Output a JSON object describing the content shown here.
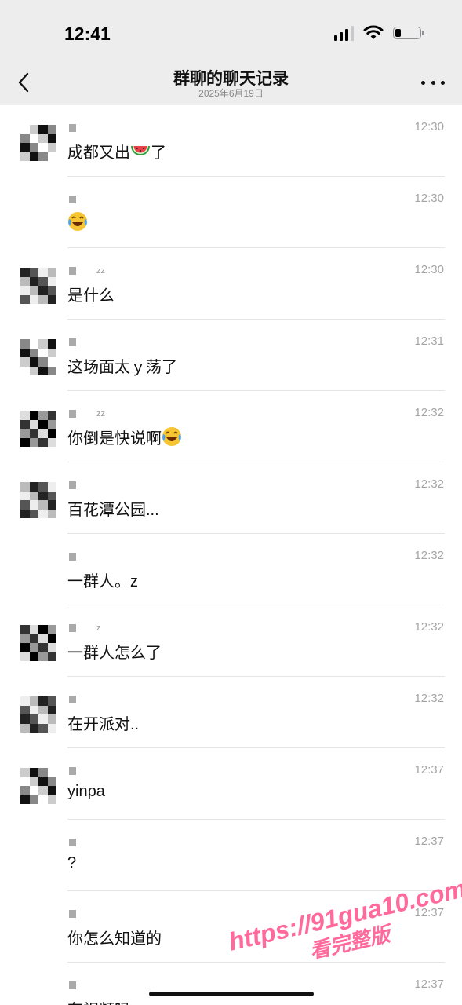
{
  "status_bar": {
    "time": "12:41"
  },
  "nav": {
    "title": "群聊的聊天记录",
    "subtitle": "2025年6月19日"
  },
  "messages": [
    {
      "sender": "",
      "time": "12:30",
      "text": "成都又出",
      "emoji": "watermelon",
      "text_after": "了"
    },
    {
      "sender": "",
      "time": "12:30",
      "text": "",
      "emoji": "laughing-crying",
      "text_after": ""
    },
    {
      "sender": "zz",
      "time": "12:30",
      "text": "是什么",
      "emoji": "",
      "text_after": ""
    },
    {
      "sender": "",
      "time": "12:31",
      "text": "这场面太ｙ荡了",
      "emoji": "",
      "text_after": ""
    },
    {
      "sender": "zz",
      "time": "12:32",
      "text": "你倒是快说啊",
      "emoji": "tears-of-joy",
      "text_after": ""
    },
    {
      "sender": "",
      "time": "12:32",
      "text": "百花潭公园...",
      "emoji": "",
      "text_after": ""
    },
    {
      "sender": "",
      "time": "12:32",
      "text": "一群人。z",
      "emoji": "",
      "text_after": ""
    },
    {
      "sender": "z",
      "time": "12:32",
      "text": "一群人怎么了",
      "emoji": "",
      "text_after": ""
    },
    {
      "sender": "",
      "time": "12:32",
      "text": "在开派对..",
      "emoji": "",
      "text_after": ""
    },
    {
      "sender": "",
      "time": "12:37",
      "text": "yinpa",
      "emoji": "",
      "text_after": ""
    },
    {
      "sender": "",
      "time": "12:37",
      "text": "?",
      "emoji": "",
      "text_after": ""
    },
    {
      "sender": "",
      "time": "12:37",
      "text": "你怎么知道的",
      "emoji": "",
      "text_after": ""
    },
    {
      "sender": "",
      "time": "12:37",
      "text": "有视频吗",
      "emoji": "",
      "text_after": ""
    }
  ],
  "watermark": {
    "line1": "https://91gua10.com",
    "line2": "看完整版"
  },
  "colors": {
    "bar_bg": "#ededed",
    "watermark": "#ff4f8b",
    "time": "#a5a5a5"
  }
}
